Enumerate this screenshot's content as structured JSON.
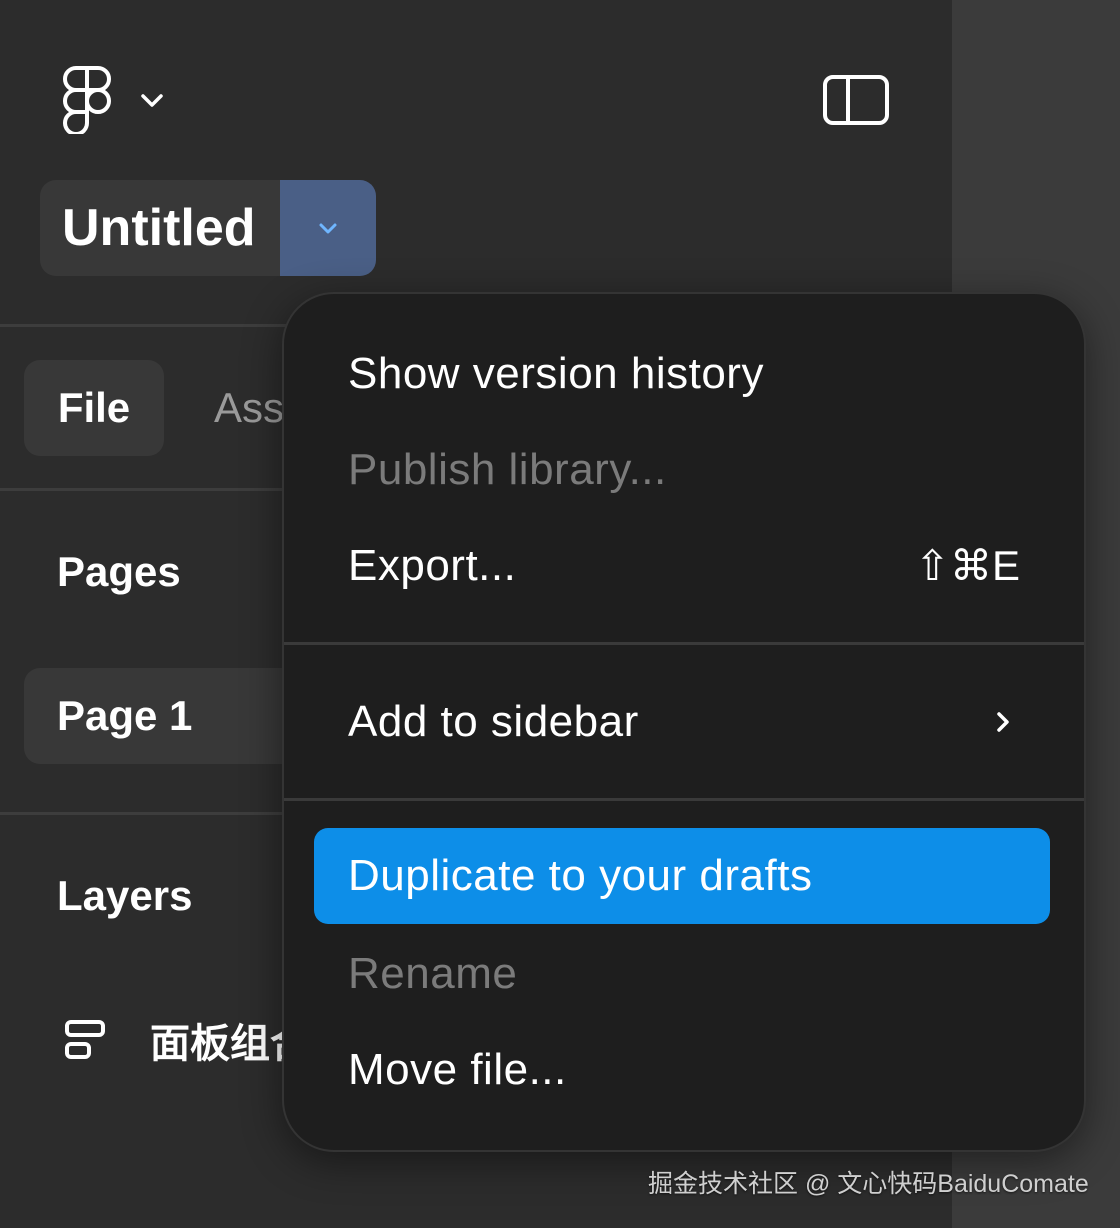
{
  "header": {
    "logo_icon": "figma-logo-icon",
    "logo_menu_icon": "chevron-down-icon",
    "sidebar_toggle_icon": "sidebar-toggle-icon"
  },
  "file": {
    "title": "Untitled",
    "dropdown_icon": "chevron-down-icon"
  },
  "tabs": [
    {
      "label": "File",
      "active": true
    },
    {
      "label": "Ass",
      "active": false
    }
  ],
  "pages": {
    "heading": "Pages",
    "items": [
      {
        "label": "Page 1",
        "selected": true
      }
    ]
  },
  "layers": {
    "heading": "Layers",
    "items": [
      {
        "label": "面板组合",
        "icon": "auto-layout-frame-icon"
      }
    ]
  },
  "context_menu": {
    "items": [
      {
        "label": "Show version history",
        "disabled": false
      },
      {
        "label": "Publish library...",
        "disabled": true
      },
      {
        "label": "Export...",
        "disabled": false,
        "shortcut": "⇧⌘E"
      },
      {
        "label": "Add to sidebar",
        "disabled": false,
        "submenu": true
      },
      {
        "label": "Duplicate to your drafts",
        "disabled": false,
        "highlighted": true
      },
      {
        "label": "Rename",
        "disabled": true
      },
      {
        "label": "Move file...",
        "disabled": false
      }
    ]
  },
  "watermark": "掘金技术社区 @ 文心快码BaiduComate",
  "colors": {
    "panel_bg": "#2c2c2c",
    "menu_bg": "#1e1e1e",
    "accent": "#0d8ee8",
    "title_dropdown_bg": "#4a5f86",
    "disabled_text": "#7b7b7b"
  }
}
